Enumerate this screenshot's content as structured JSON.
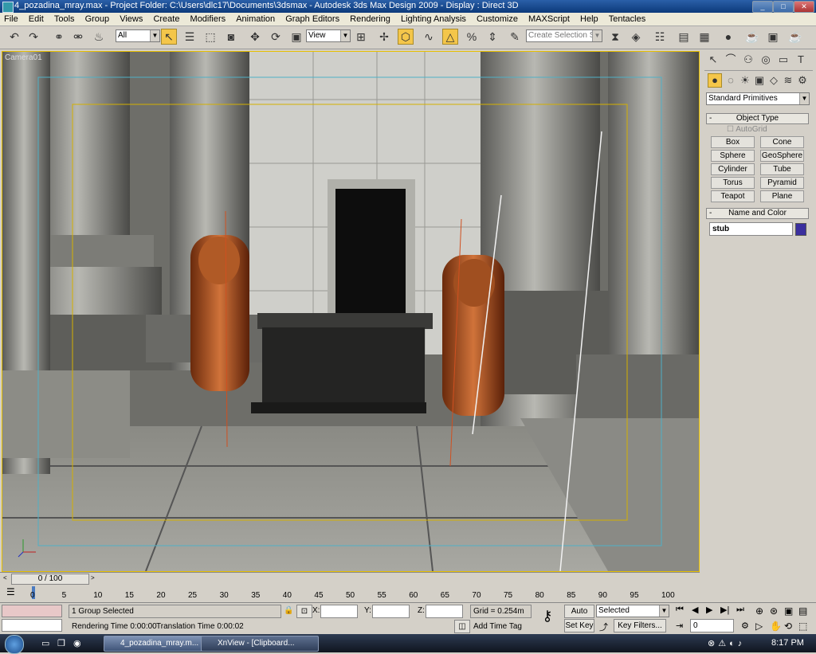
{
  "window": {
    "title": "4_pozadina_mray.max    - Project Folder: C:\\Users\\dlc17\\Documents\\3dsmax    - Autodesk 3ds Max Design 2009    - Display : Direct 3D"
  },
  "menu": [
    "File",
    "Edit",
    "Tools",
    "Group",
    "Views",
    "Create",
    "Modifiers",
    "Animation",
    "Graph Editors",
    "Rendering",
    "Lighting Analysis",
    "Customize",
    "MAXScript",
    "Help",
    "Tentacles"
  ],
  "toolbar": {
    "selection_filter": "All",
    "reference_coord": "View",
    "named_selection_placeholder": "Create Selection Set"
  },
  "viewport": {
    "label": "Camera01"
  },
  "command_panel": {
    "category": "Standard Primitives",
    "object_type_title": "Object Type",
    "autogrid_label": "AutoGrid",
    "buttons": [
      "Box",
      "Cone",
      "Sphere",
      "GeoSphere",
      "Cylinder",
      "Tube",
      "Torus",
      "Pyramid",
      "Teapot",
      "Plane"
    ],
    "name_color_title": "Name and Color",
    "object_name": "stub",
    "object_color": "#3b2f9e"
  },
  "time_slider": {
    "label": "0 / 100",
    "ticks": [
      "0",
      "5",
      "10",
      "15",
      "20",
      "25",
      "30",
      "35",
      "40",
      "45",
      "50",
      "55",
      "60",
      "65",
      "70",
      "75",
      "80",
      "85",
      "90",
      "95",
      "100"
    ]
  },
  "status": {
    "selection_text": "1 Group Selected",
    "rendering_time": "Rendering Time  0:00:00",
    "translation_time": "Translation Time  0:00:02",
    "x_label": "X:",
    "y_label": "Y:",
    "z_label": "Z:",
    "grid": "Grid = 0.254m",
    "add_time_tag": "Add Time Tag",
    "auto_key": "Auto Key",
    "set_key": "Set Key",
    "key_mode": "Selected",
    "key_filters": "Key Filters...",
    "frame": "0"
  },
  "taskbar": {
    "tasks": [
      "4_pozadina_mray.m...",
      "XnView - [Clipboard..."
    ],
    "clock": "8:17 PM"
  }
}
